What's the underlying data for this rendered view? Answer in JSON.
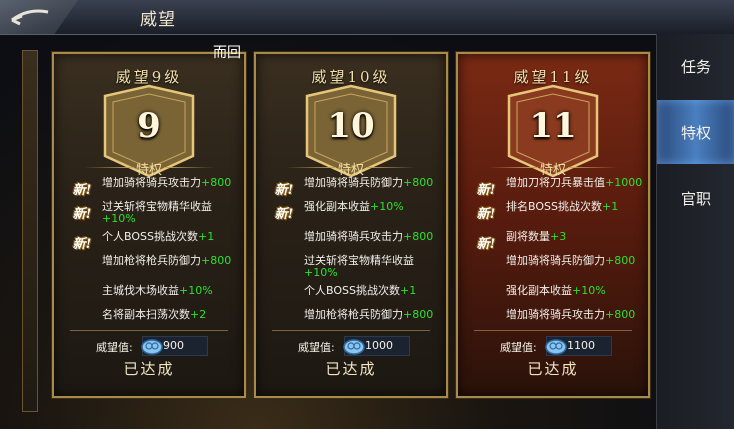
{
  "header": {
    "title": "威望"
  },
  "overlay_text": "而回",
  "tabs": [
    {
      "label": "任务",
      "active": false
    },
    {
      "label": "特权",
      "active": true
    },
    {
      "label": "官职",
      "active": false
    }
  ],
  "prestige_label": "威望值:",
  "privilege_heading": "特权",
  "new_tag": "新!",
  "reached_label": "已达成",
  "cards": [
    {
      "title": "威望9级",
      "level": "9",
      "prestige": "900",
      "theme": "gold",
      "items": [
        {
          "text": "增加骑将骑兵攻击力",
          "bonus": "+800",
          "new": true
        },
        {
          "text": "过关斩将宝物精华收益",
          "bonus": "+10%",
          "new": true
        },
        {
          "text": "个人BOSS挑战次数",
          "bonus": "+1",
          "new": true
        },
        {
          "text": "增加枪将枪兵防御力",
          "bonus": "+800",
          "new": false
        },
        {
          "text": "主城伐木场收益",
          "bonus": "+10%",
          "new": false
        },
        {
          "text": "名将副本扫荡次数",
          "bonus": "+2",
          "new": false
        }
      ]
    },
    {
      "title": "威望10级",
      "level": "10",
      "prestige": "1000",
      "theme": "gold",
      "items": [
        {
          "text": "增加骑将骑兵防御力",
          "bonus": "+800",
          "new": true
        },
        {
          "text": "强化副本收益",
          "bonus": "+10%",
          "new": true
        },
        {
          "text": "增加骑将骑兵攻击力",
          "bonus": "+800",
          "new": false
        },
        {
          "text": "过关斩将宝物精华收益",
          "bonus": "+10%",
          "new": false
        },
        {
          "text": "个人BOSS挑战次数",
          "bonus": "+1",
          "new": false
        },
        {
          "text": "增加枪将枪兵防御力",
          "bonus": "+800",
          "new": false
        }
      ]
    },
    {
      "title": "威望11级",
      "level": "11",
      "prestige": "1100",
      "theme": "red",
      "items": [
        {
          "text": "增加刀将刀兵暴击值",
          "bonus": "+1000",
          "new": true
        },
        {
          "text": "排名BOSS挑战次数",
          "bonus": "+1",
          "new": true
        },
        {
          "text": "副将数量",
          "bonus": "+3",
          "new": true
        },
        {
          "text": "增加骑将骑兵防御力",
          "bonus": "+800",
          "new": false
        },
        {
          "text": "强化副本收益",
          "bonus": "+10%",
          "new": false
        },
        {
          "text": "增加骑将骑兵攻击力",
          "bonus": "+800",
          "new": false
        }
      ]
    }
  ]
}
